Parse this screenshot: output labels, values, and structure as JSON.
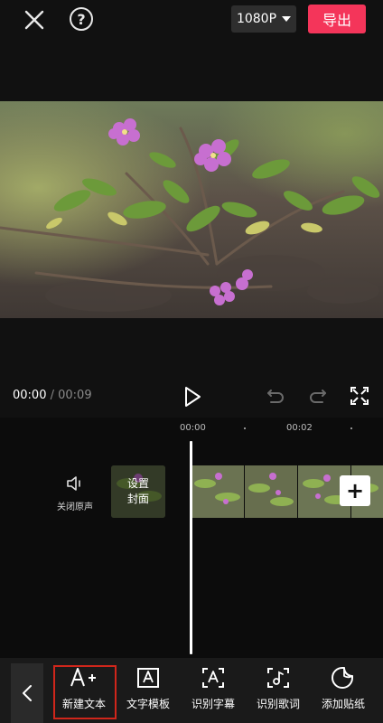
{
  "topbar": {
    "close_icon": "close-icon",
    "help_label": "?",
    "resolution": "1080P",
    "export_label": "导出"
  },
  "preview": {
    "image": "flower-branch-video-frame"
  },
  "controls": {
    "current_time": "00:00",
    "separator": " / ",
    "total_time": "00:09",
    "icons": [
      "play-icon",
      "undo-icon",
      "redo-icon",
      "fullscreen-icon"
    ]
  },
  "timeline": {
    "ruler": [
      "00:00",
      "00:02"
    ],
    "mute_label": "关闭原声",
    "cover_line1": "设置",
    "cover_line2": "封面",
    "add_label": "+"
  },
  "toolbar": {
    "items": [
      {
        "label": "新建文本",
        "icon": "new-text-icon"
      },
      {
        "label": "文字模板",
        "icon": "text-template-icon"
      },
      {
        "label": "识别字幕",
        "icon": "recognize-subtitle-icon"
      },
      {
        "label": "识别歌词",
        "icon": "recognize-lyrics-icon"
      },
      {
        "label": "添加贴纸",
        "icon": "add-sticker-icon"
      }
    ]
  },
  "colors": {
    "accent": "#f4355a",
    "background": "#111111",
    "highlight": "#d0261b"
  }
}
